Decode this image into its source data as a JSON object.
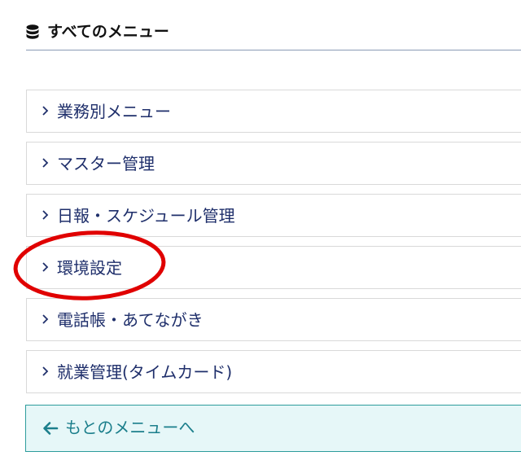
{
  "header": {
    "title": "すべてのメニュー",
    "icon": "database-icon"
  },
  "menu": {
    "items": [
      {
        "label": "業務別メニュー"
      },
      {
        "label": "マスター管理"
      },
      {
        "label": "日報・スケジュール管理"
      },
      {
        "label": "環境設定"
      },
      {
        "label": "電話帳・あてながき"
      },
      {
        "label": "就業管理(タイムカード)"
      }
    ]
  },
  "back": {
    "label": "もとのメニューへ"
  },
  "colors": {
    "menu_text": "#1f2f6b",
    "back_text": "#1c7f8c",
    "back_bg": "#e6f7f8",
    "annotation": "#e00000"
  }
}
